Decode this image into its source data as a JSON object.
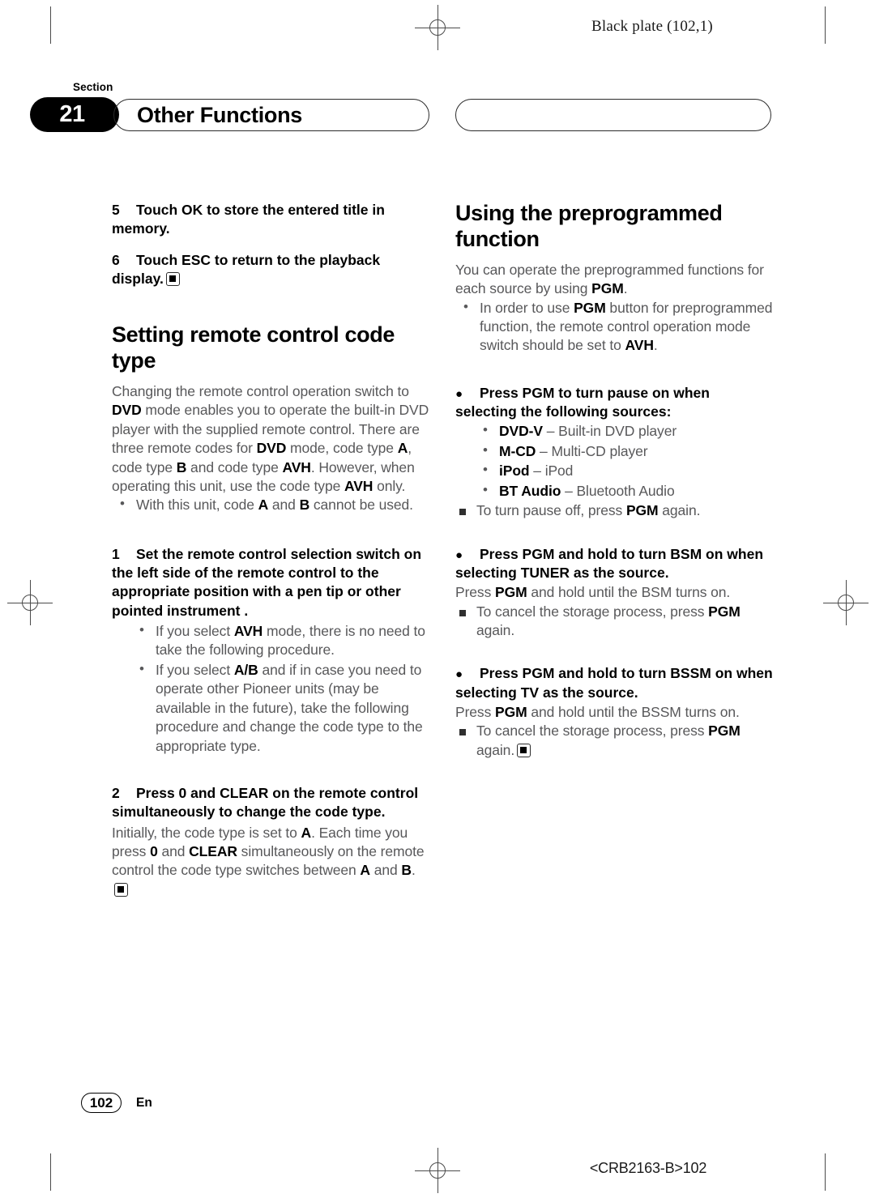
{
  "page": {
    "plate_label": "Black plate (102,1)",
    "section_word": "Section",
    "section_number": "21",
    "section_title": "Other Functions",
    "right_header_title": "",
    "page_number": "102",
    "language": "En",
    "doc_code": "<CRB2163-B>102"
  },
  "left_column": {
    "step5": {
      "num": "5",
      "text": "Touch OK to store the entered title in memory."
    },
    "step6": {
      "num": "6",
      "text": "Touch ESC to return to the playback display."
    },
    "heading": "Setting remote control code type",
    "intro_p1_a": "Changing the remote control operation switch to ",
    "intro_b1": "DVD",
    "intro_p1_b": " mode enables you to operate the built-in DVD player with the supplied remote control. There are three remote codes for ",
    "intro_b2": "DVD",
    "intro_p1_c": " mode, code type ",
    "intro_b3": "A",
    "intro_p1_d": ", code type ",
    "intro_b4": "B",
    "intro_p1_e": " and code type ",
    "intro_b5": "AVH",
    "intro_p1_f": ". However, when operating this unit, use the code type ",
    "intro_b6": "AVH",
    "intro_p1_g": " only.",
    "bullet_unit_a": "With this unit, code ",
    "bullet_unit_b1": "A",
    "bullet_unit_b": " and ",
    "bullet_unit_b2": "B",
    "bullet_unit_c": " cannot be used.",
    "step1": {
      "num": "1",
      "text": "Set the remote control selection switch on the left side of the remote control to the appropriate position with a pen tip or other pointed instrument ."
    },
    "step1_bullet1_a": "If you select ",
    "step1_bullet1_b": "AVH",
    "step1_bullet1_c": " mode, there is no need to take the following procedure.",
    "step1_bullet2_a": "If you select ",
    "step1_bullet2_b": "A/B",
    "step1_bullet2_c": " and if in case you need to operate other Pioneer units (may be available in the future), take the following procedure and change the code type to the appropriate type.",
    "step2": {
      "num": "2",
      "text": "Press 0 and CLEAR on the remote control simultaneously to change the code type."
    },
    "step2_body_a": "Initially, the code type is set to ",
    "step2_body_b1": "A",
    "step2_body_b": ". Each time you press ",
    "step2_body_b2": "0",
    "step2_body_c": " and ",
    "step2_body_b3": "CLEAR",
    "step2_body_d": " simultaneously on the remote control the code type switches between ",
    "step2_body_b4": "A",
    "step2_body_e": " and ",
    "step2_body_b5": "B",
    "step2_body_f": "."
  },
  "right_column": {
    "heading": "Using the preprogrammed function",
    "intro_a": "You can operate the preprogrammed functions for each source by using ",
    "intro_b": "PGM",
    "intro_c": ".",
    "intro_bullet_a": "In order to use ",
    "intro_bullet_b": "PGM",
    "intro_bullet_c": " button for preprogrammed function, the remote control operation mode switch should be set to ",
    "intro_bullet_b2": "AVH",
    "intro_bullet_d": ".",
    "sec1_head": "Press PGM to turn pause on when selecting the following sources:",
    "sources": [
      {
        "term": "DVD-V",
        "dash": " – ",
        "desc": "Built-in DVD player"
      },
      {
        "term": "M-CD",
        "dash": " – ",
        "desc": "Multi-CD player"
      },
      {
        "term": "iPod",
        "dash": " – ",
        "desc": "iPod"
      },
      {
        "term": "BT Audio",
        "dash": " – ",
        "desc": "Bluetooth Audio"
      }
    ],
    "sec1_note_a": "To turn pause off, press ",
    "sec1_note_b": "PGM",
    "sec1_note_c": " again.",
    "sec2_head": "Press PGM and hold to turn BSM on when selecting TUNER as the source.",
    "sec2_body_a": "Press ",
    "sec2_body_b": "PGM",
    "sec2_body_c": " and hold until the BSM turns on.",
    "sec2_note_a": "To cancel the storage process, press ",
    "sec2_note_b": "PGM",
    "sec2_note_c": " again.",
    "sec3_head": "Press PGM and hold to turn BSSM on when selecting TV as the source.",
    "sec3_body_a": "Press ",
    "sec3_body_b": "PGM",
    "sec3_body_c": " and hold until the BSSM turns on.",
    "sec3_note_a": "To cancel the storage process, press ",
    "sec3_note_b": "PGM",
    "sec3_note_c": " again."
  },
  "colors": {
    "body_text": "#58585a",
    "emphasis_text": "#000000",
    "reg_mark": "#4a4a4a"
  }
}
